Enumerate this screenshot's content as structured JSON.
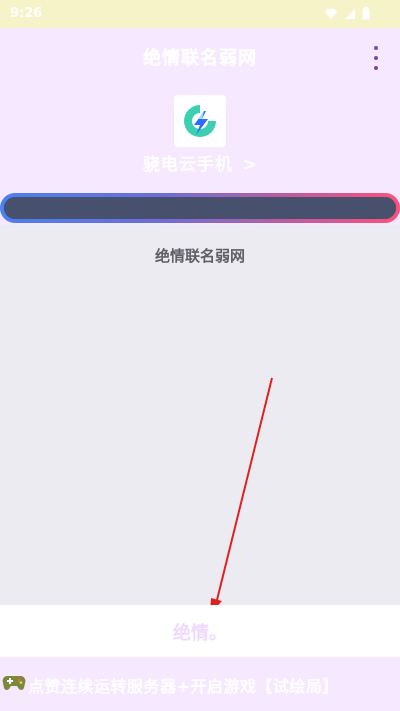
{
  "status_bar": {
    "time": "9:26"
  },
  "header": {
    "title": "绝情联名弱网"
  },
  "provider": {
    "name": "骁电云手机",
    "chevron": ">"
  },
  "progress": {
    "value": 1.0
  },
  "panel": {
    "title": "绝情联名弱网"
  },
  "action": {
    "label": "绝情。"
  },
  "footer": {
    "text": "点赞连续运转服务器+开启游戏【试绘局】"
  },
  "icons": {
    "wifi": "wifi-icon",
    "signal": "signal-icon",
    "battery": "battery-icon",
    "menu": "more-vertical-icon",
    "logo": "lightning-logo-icon",
    "gamepad": "gamepad-icon"
  },
  "colors": {
    "background": "#f6e8ff",
    "panel": "#ebebf1",
    "arrow": "#e02020",
    "menu_dots": "#7a4b9f",
    "logo_teal": "#3ccfb0",
    "logo_blue": "#2b6cff"
  }
}
